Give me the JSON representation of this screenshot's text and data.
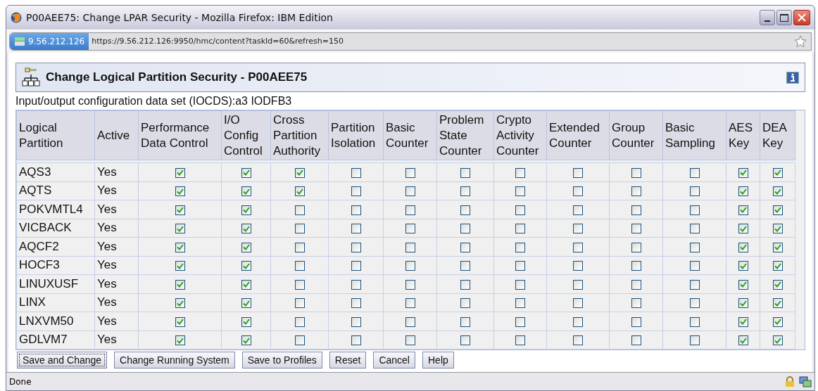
{
  "window": {
    "title": "P00AEE75: Change LPAR Security - Mozilla Firefox: IBM Edition"
  },
  "address_bar": {
    "site": "9.56.212.126",
    "url": "https://9.56.212.126:9950/hmc/content?taskId=60&refresh=150"
  },
  "panel": {
    "title": "Change Logical Partition Security - P00AEE75",
    "iocds_label": "Input/output configuration data set (IOCDS):",
    "iocds_value": "a3 IODFB3"
  },
  "table": {
    "columns": [
      "Logical Partition",
      "Active",
      "Performance Data Control",
      "I/O Config Control",
      "Cross Partition Authority",
      "Partition Isolation",
      "Basic Counter",
      "Problem State Counter",
      "Crypto Activity Counter",
      "Extended Counter",
      "Group Counter",
      "Basic Sampling",
      "AES Key",
      "DEA Key"
    ],
    "rows": [
      {
        "partition": "AQS3",
        "active": "Yes",
        "settings": [
          {
            "checked": true
          },
          {
            "checked": true
          },
          {
            "checked": true
          },
          {
            "checked": false
          },
          {
            "checked": false
          },
          {
            "checked": false
          },
          {
            "checked": false
          },
          {
            "checked": false
          },
          {
            "checked": false
          },
          {
            "checked": false
          },
          {
            "checked": true
          },
          {
            "checked": true
          }
        ]
      },
      {
        "partition": "AQTS",
        "active": "Yes",
        "settings": [
          {
            "checked": true
          },
          {
            "checked": true
          },
          {
            "checked": true
          },
          {
            "checked": false
          },
          {
            "checked": false
          },
          {
            "checked": false
          },
          {
            "checked": false
          },
          {
            "checked": false
          },
          {
            "checked": false
          },
          {
            "checked": false
          },
          {
            "checked": true
          },
          {
            "checked": true
          }
        ]
      },
      {
        "partition": "POKVMTL4",
        "active": "Yes",
        "settings": [
          {
            "checked": true
          },
          {
            "checked": true
          },
          {
            "checked": false
          },
          {
            "checked": false
          },
          {
            "checked": false
          },
          {
            "checked": false
          },
          {
            "checked": false
          },
          {
            "checked": false
          },
          {
            "checked": false
          },
          {
            "checked": false
          },
          {
            "checked": true
          },
          {
            "checked": true
          }
        ]
      },
      {
        "partition": "VICBACK",
        "active": "Yes",
        "settings": [
          {
            "checked": true
          },
          {
            "checked": true
          },
          {
            "checked": false
          },
          {
            "checked": false
          },
          {
            "checked": false
          },
          {
            "checked": false
          },
          {
            "checked": false
          },
          {
            "checked": false
          },
          {
            "checked": false
          },
          {
            "checked": false
          },
          {
            "checked": true
          },
          {
            "checked": true
          }
        ]
      },
      {
        "partition": "AQCF2",
        "active": "Yes",
        "settings": [
          {
            "checked": true
          },
          {
            "checked": true
          },
          {
            "checked": false
          },
          {
            "checked": false
          },
          {
            "checked": false
          },
          {
            "checked": false
          },
          {
            "checked": false
          },
          {
            "checked": false
          },
          {
            "checked": false
          },
          {
            "checked": false
          },
          {
            "checked": true
          },
          {
            "checked": true
          }
        ]
      },
      {
        "partition": "HOCF3",
        "active": "Yes",
        "settings": [
          {
            "checked": true
          },
          {
            "checked": true
          },
          {
            "checked": false
          },
          {
            "checked": false
          },
          {
            "checked": false
          },
          {
            "checked": false
          },
          {
            "checked": false
          },
          {
            "checked": false
          },
          {
            "checked": false
          },
          {
            "checked": false
          },
          {
            "checked": true
          },
          {
            "checked": true
          }
        ]
      },
      {
        "partition": "LINUXUSF",
        "active": "Yes",
        "settings": [
          {
            "checked": true
          },
          {
            "checked": true
          },
          {
            "checked": false
          },
          {
            "checked": false
          },
          {
            "checked": false
          },
          {
            "checked": false
          },
          {
            "checked": false
          },
          {
            "checked": false
          },
          {
            "checked": false
          },
          {
            "checked": false
          },
          {
            "checked": true
          },
          {
            "checked": true
          }
        ]
      },
      {
        "partition": "LINX",
        "active": "Yes",
        "settings": [
          {
            "checked": true
          },
          {
            "checked": true
          },
          {
            "checked": false
          },
          {
            "checked": false
          },
          {
            "checked": false
          },
          {
            "checked": false
          },
          {
            "checked": false
          },
          {
            "checked": false
          },
          {
            "checked": false
          },
          {
            "checked": false
          },
          {
            "checked": true
          },
          {
            "checked": true
          }
        ]
      },
      {
        "partition": "LNXVM50",
        "active": "Yes",
        "settings": [
          {
            "checked": true
          },
          {
            "checked": true
          },
          {
            "checked": false
          },
          {
            "checked": false
          },
          {
            "checked": false
          },
          {
            "checked": false
          },
          {
            "checked": false
          },
          {
            "checked": false
          },
          {
            "checked": false
          },
          {
            "checked": false
          },
          {
            "checked": true
          },
          {
            "checked": true
          }
        ]
      },
      {
        "partition": "GDLVM7",
        "active": "Yes",
        "settings": [
          {
            "checked": true
          },
          {
            "checked": true
          },
          {
            "checked": false
          },
          {
            "checked": false
          },
          {
            "checked": false
          },
          {
            "checked": false
          },
          {
            "checked": false
          },
          {
            "checked": false
          },
          {
            "checked": false
          },
          {
            "checked": false
          },
          {
            "checked": true
          },
          {
            "checked": true
          }
        ]
      }
    ]
  },
  "buttons": [
    {
      "label": "Save and Change",
      "focused": true
    },
    {
      "label": "Change Running System",
      "focused": false
    },
    {
      "label": "Save to Profiles",
      "focused": false
    },
    {
      "label": "Reset",
      "focused": false
    },
    {
      "label": "Cancel",
      "focused": false
    },
    {
      "label": "Help",
      "focused": false
    }
  ],
  "status_bar": {
    "text": "Done"
  }
}
